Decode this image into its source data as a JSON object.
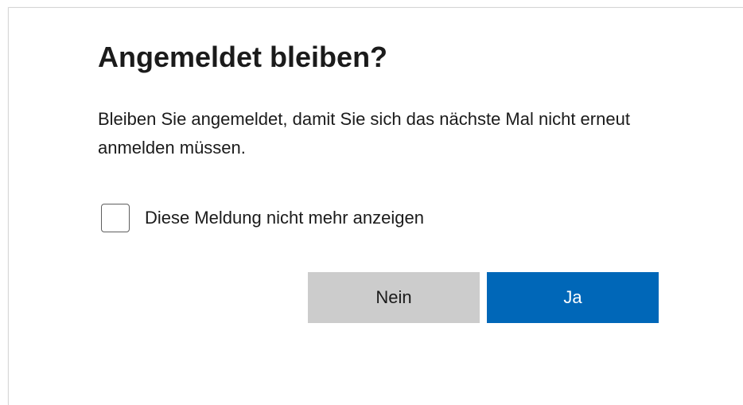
{
  "dialog": {
    "title": "Angemeldet bleiben?",
    "description": "Bleiben Sie angemeldet, damit Sie sich das nächste Mal nicht erneut anmelden müssen.",
    "checkbox": {
      "label": "Diese Meldung nicht mehr anzeigen",
      "checked": false
    },
    "buttons": {
      "no_label": "Nein",
      "yes_label": "Ja"
    }
  },
  "colors": {
    "primary_button": "#0067b8",
    "secondary_button": "#cccccc",
    "text": "#1b1b1b"
  }
}
